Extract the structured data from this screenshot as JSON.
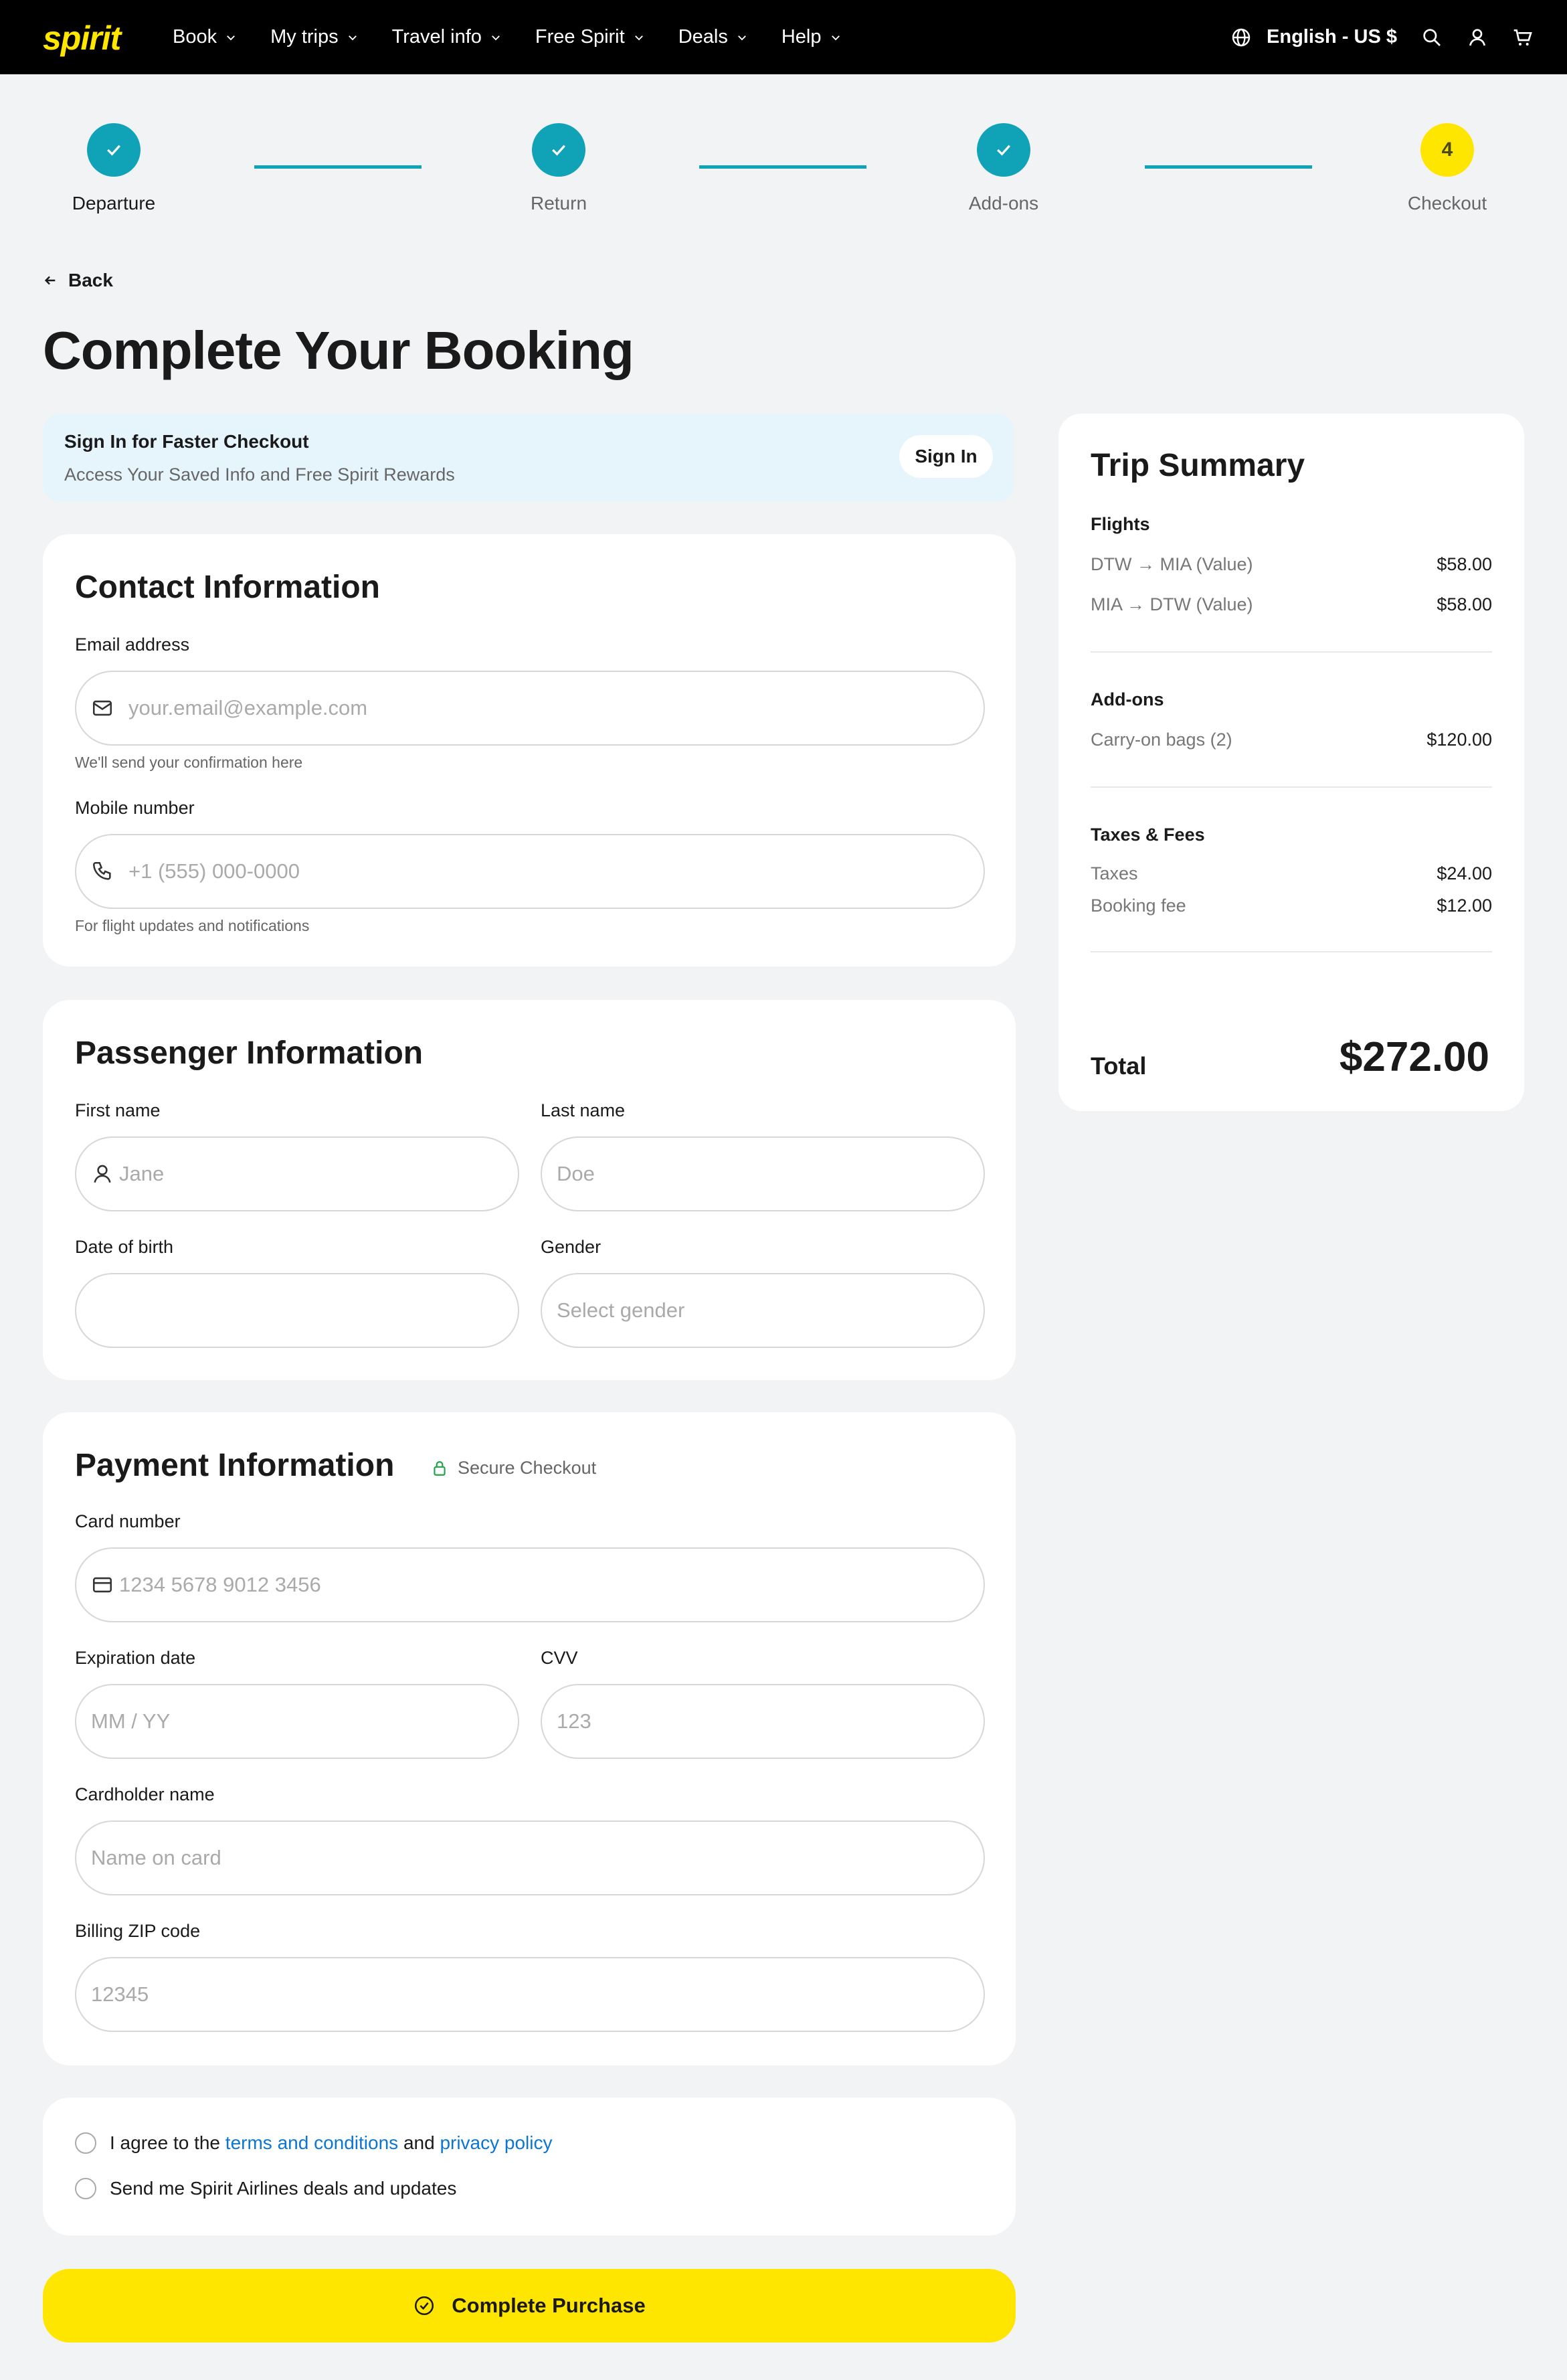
{
  "nav": {
    "logo": "spirit",
    "items": [
      {
        "label": "Book"
      },
      {
        "label": "My trips"
      },
      {
        "label": "Travel info"
      },
      {
        "label": "Free Spirit"
      },
      {
        "label": "Deals"
      },
      {
        "label": "Help"
      }
    ],
    "language": "English - US $",
    "icons": [
      "globe-icon",
      "search-icon",
      "user-icon",
      "cart-icon"
    ]
  },
  "progress": {
    "steps": [
      {
        "label": "Departure",
        "state": "done"
      },
      {
        "label": "Return",
        "state": "done"
      },
      {
        "label": "Add-ons",
        "state": "done"
      },
      {
        "label": "Checkout",
        "state": "current",
        "number": "4"
      }
    ],
    "done_color": "#10a3b8",
    "current_color": "#ffe600"
  },
  "back_label": "Back",
  "page_title": "Complete Your Booking",
  "signin": {
    "title": "Sign In for Faster Checkout",
    "subtitle": "Access Your Saved Info and Free Spirit Rewards",
    "button": "Sign In"
  },
  "contact": {
    "title": "Contact Information",
    "email_label": "Email address",
    "email_placeholder": "your.email@example.com",
    "email_hint": "We'll send your confirmation here",
    "mobile_label": "Mobile number",
    "mobile_placeholder": "+1 (555) 000-0000",
    "mobile_hint": "For flight updates and notifications"
  },
  "passenger": {
    "title": "Passenger Information",
    "first_label": "First name",
    "first_placeholder": "Jane",
    "last_label": "Last name",
    "last_placeholder": "Doe",
    "dob_label": "Date of birth",
    "dob_value": "",
    "gender_label": "Gender",
    "gender_placeholder": "Select gender"
  },
  "payment": {
    "title": "Payment Information",
    "secure": "Secure Checkout",
    "card_label": "Card number",
    "card_placeholder": "1234 5678 9012 3456",
    "exp_label": "Expiration date",
    "exp_placeholder": "MM / YY",
    "cvv_label": "CVV",
    "cvv_placeholder": "123",
    "name_label": "Cardholder name",
    "name_placeholder": "Name on card",
    "zip_label": "Billing ZIP code",
    "zip_placeholder": "12345"
  },
  "agreements": {
    "terms_prefix": "I agree to the",
    "terms_link": "terms and conditions",
    "terms_and": "and",
    "privacy_link": "privacy policy",
    "deals": "Send me Spirit Airlines deals and updates"
  },
  "purchase_button": "Complete Purchase",
  "summary": {
    "title": "Trip Summary",
    "flights_heading": "Flights",
    "flights": [
      {
        "label": "DTW → MIA (Value)",
        "price": "$58.00"
      },
      {
        "label": "MIA → DTW (Value)",
        "price": "$58.00"
      }
    ],
    "addons_heading": "Add-ons",
    "addons": [
      {
        "label": "Carry-on bags (2)",
        "price": "$120.00"
      }
    ],
    "taxes_heading": "Taxes & Fees",
    "taxes": [
      {
        "label": "Taxes",
        "price": "$24.00"
      },
      {
        "label": "Booking fee",
        "price": "$12.00"
      }
    ],
    "total_label": "Total",
    "total_value": "$272.00"
  }
}
